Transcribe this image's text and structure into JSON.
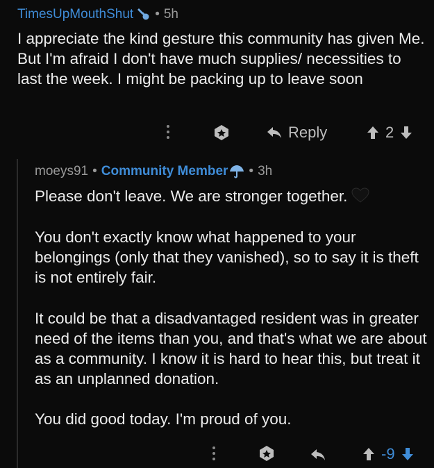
{
  "comments": [
    {
      "username": "TimesUpMouthShut",
      "user_icon": "wrench-icon",
      "time": "5h",
      "body": "I appreciate the kind gesture this community has given Me. But I'm afraid I don't have much supplies/ necessities to last the week. I might be packing up to leave soon",
      "actions": {
        "more_icon": "more-vertical-icon",
        "award_icon": "award-icon",
        "reply_label": "Reply",
        "score": "2"
      }
    },
    {
      "username": "moeys91",
      "flair": "Community Member",
      "flair_icon": "umbrella-icon",
      "time": "3h",
      "paragraphs": [
        "Please don't leave. We are stronger together.",
        "You don't exactly know what happened to your belongings (only that they vanished), so to say it is theft is not entirely fair.",
        "It could be that a disadvantaged resident was in greater need of the items than you, and that's what we are about as a community. I know it is hard to hear this, but treat it as an unplanned donation.",
        "You did good today. I'm proud of you."
      ],
      "emoji": "black-heart-icon",
      "actions": {
        "more_icon": "more-vertical-icon",
        "award_icon": "award-icon",
        "score": "-9"
      }
    }
  ],
  "colors": {
    "background": "#0b0b0b",
    "link": "#3f8cd7",
    "text": "#ececec",
    "muted": "#9a9a9a"
  }
}
